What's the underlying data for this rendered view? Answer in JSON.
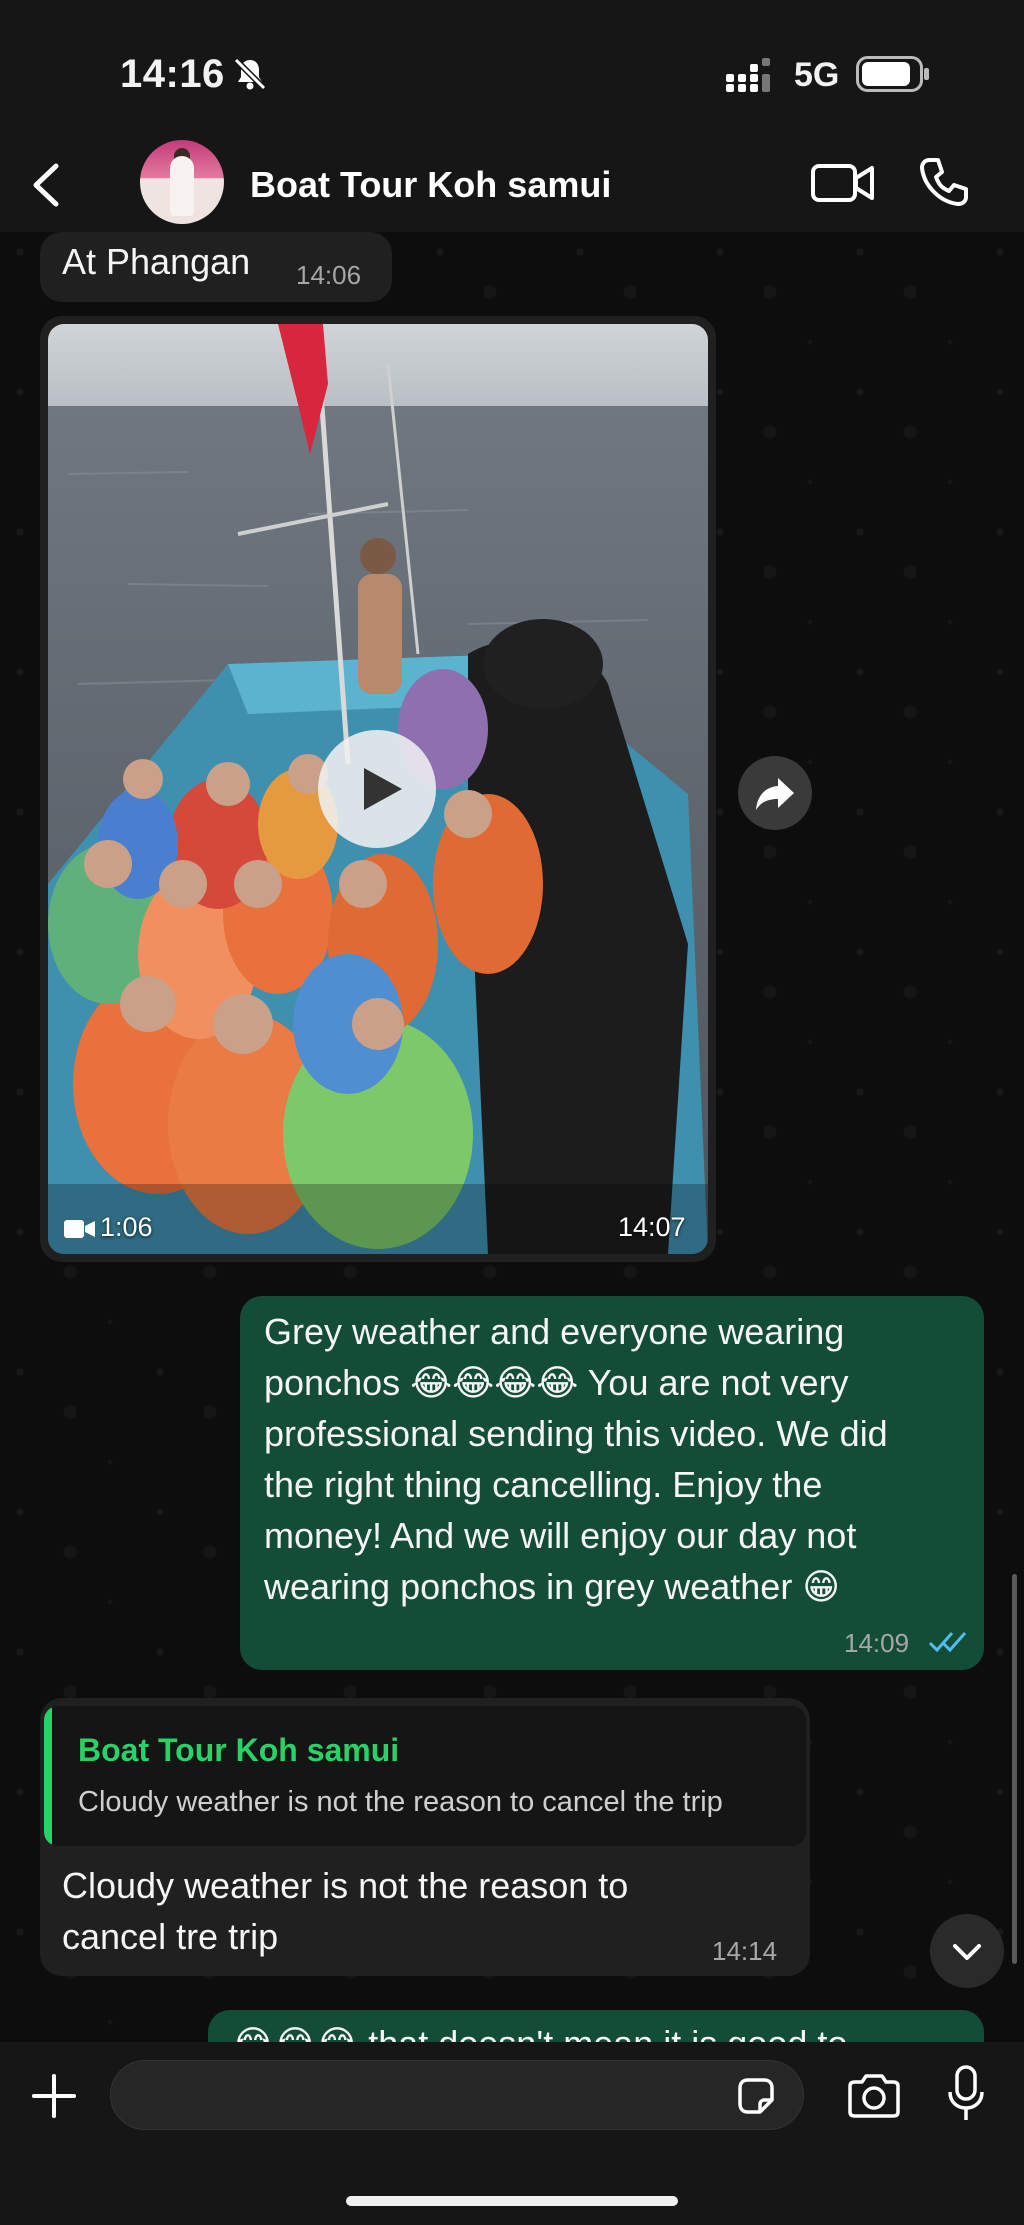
{
  "status_bar": {
    "time": "14:16",
    "network": "5G"
  },
  "header": {
    "title": "Boat Tour Koh samui"
  },
  "messages": {
    "m1": {
      "text": "At Phangan",
      "time": "14:06"
    },
    "video": {
      "duration": "1:06",
      "time": "14:07"
    },
    "m2": {
      "lines": [
        "Grey weather and everyone wearing",
        "ponchos 😂😂😂😂 You are not very",
        "professional sending this video. We did",
        "the right thing cancelling. Enjoy the",
        "money! And we will enjoy our day not",
        "wearing ponchos in grey weather 😁"
      ],
      "time": "14:09"
    },
    "m3": {
      "quote_author": "Boat Tour Koh samui",
      "quote_text": "Cloudy weather is not the reason to cancel the trip",
      "lines": [
        "Cloudy weather is not the reason to",
        "cancel tre trip"
      ],
      "time": "14:14"
    },
    "m4": {
      "partial_text": "😂😂😂 that doesn't mean it is good to"
    }
  },
  "composer": {
    "value": "",
    "placeholder": ""
  },
  "colors": {
    "outgoing_bubble": "#134d37",
    "incoming_bubble": "#202020",
    "accent": "#25d366",
    "read_ticks": "#53bdeb"
  },
  "icons": [
    "bell-slash-icon",
    "signal-icon",
    "battery-icon",
    "back-icon",
    "video-call-icon",
    "phone-icon",
    "play-icon",
    "forward-icon",
    "video-camera-icon",
    "read-ticks-icon",
    "chevron-down-icon",
    "plus-icon",
    "sticker-icon",
    "camera-icon",
    "mic-icon"
  ]
}
